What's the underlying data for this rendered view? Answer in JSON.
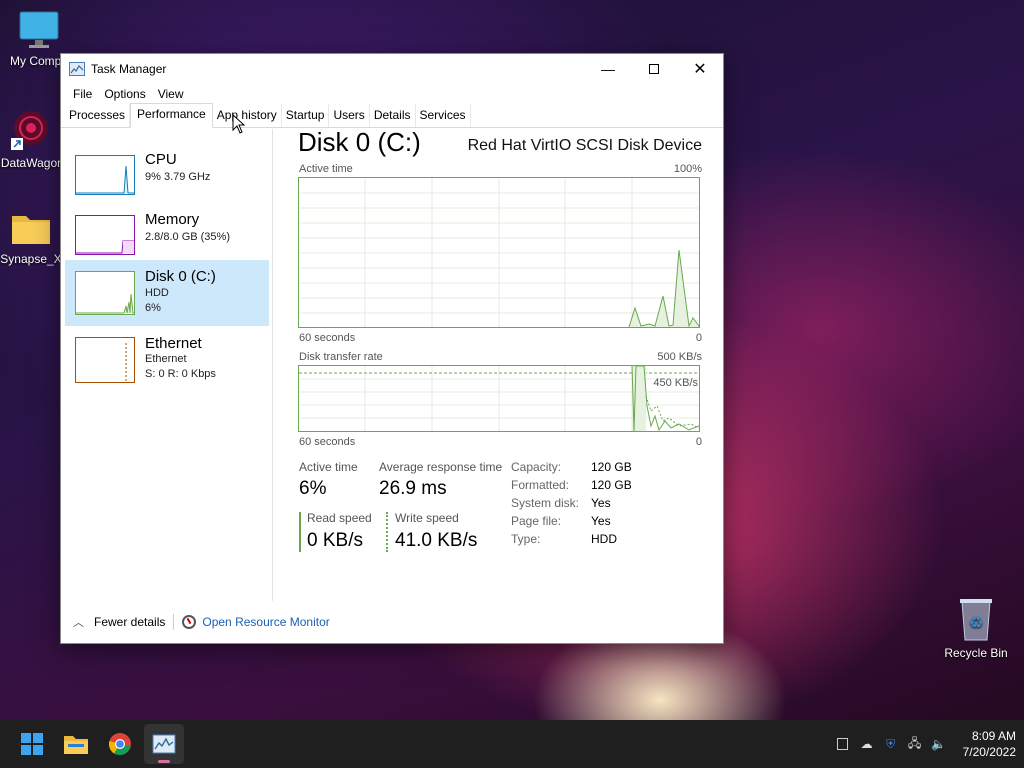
{
  "desktop": {
    "icons": [
      {
        "label": "My Compu"
      },
      {
        "label": "DataWagor"
      },
      {
        "label": "Synapse_X"
      },
      {
        "label": "Recycle Bin"
      }
    ]
  },
  "window": {
    "title": "Task Manager",
    "menu": [
      "File",
      "Options",
      "View"
    ],
    "tabs": [
      "Processes",
      "Performance",
      "App history",
      "Startup",
      "Users",
      "Details",
      "Services"
    ],
    "active_tab": "Performance"
  },
  "left_items": [
    {
      "name": "CPU",
      "line1": "9% 3.79 GHz",
      "line2": ""
    },
    {
      "name": "Memory",
      "line1": "2.8/8.0 GB (35%)",
      "line2": ""
    },
    {
      "name": "Disk 0 (C:)",
      "line1": "HDD",
      "line2": "6%"
    },
    {
      "name": "Ethernet",
      "line1": "Ethernet",
      "line2": "S: 0 R: 0 Kbps"
    }
  ],
  "detail": {
    "title": "Disk 0 (C:)",
    "model": "Red Hat VirtIO SCSI Disk Device",
    "graph1": {
      "label": "Active time",
      "max": "100%",
      "xlabel": "60 seconds",
      "min": "0"
    },
    "graph2": {
      "label": "Disk transfer rate",
      "max": "500 KB/s",
      "marker": "450 KB/s",
      "xlabel": "60 seconds",
      "min": "0"
    },
    "stats": {
      "active_time_label": "Active time",
      "active_time": "6%",
      "avg_resp_label": "Average response time",
      "avg_resp": "26.9 ms",
      "read_label": "Read speed",
      "read": "0 KB/s",
      "write_label": "Write speed",
      "write": "41.0 KB/s"
    },
    "props": [
      {
        "k": "Capacity:",
        "v": "120 GB"
      },
      {
        "k": "Formatted:",
        "v": "120 GB"
      },
      {
        "k": "System disk:",
        "v": "Yes"
      },
      {
        "k": "Page file:",
        "v": "Yes"
      },
      {
        "k": "Type:",
        "v": "HDD"
      }
    ]
  },
  "footer": {
    "fewer": "Fewer details",
    "monitor": "Open Resource Monitor"
  },
  "taskbar": {
    "time": "8:09 AM",
    "date": "7/20/2022"
  },
  "colors": {
    "disk_green": "#6aa84f",
    "cpu_blue": "#117dbb",
    "mem_purple": "#8b12ae",
    "eth_orange": "#a74f01",
    "selected": "#cde8fb",
    "link": "#1a5fb4"
  }
}
